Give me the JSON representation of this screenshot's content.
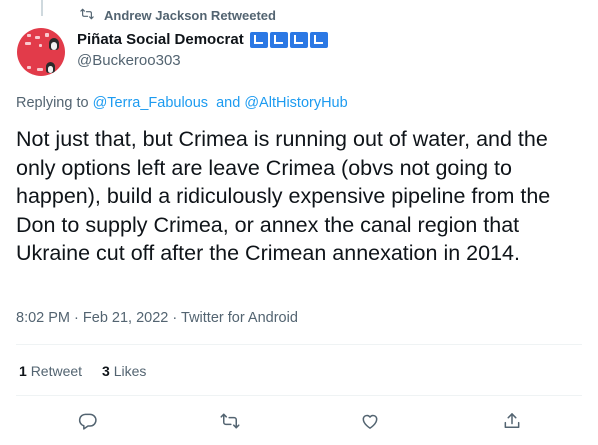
{
  "retweet_banner": {
    "icon": "retweet-icon",
    "text": "Andrew Jackson Retweeted"
  },
  "author": {
    "display_name": "Piñata Social Democrat",
    "handle": "@Buckeroo303",
    "avatar_color": "#e23b4a",
    "flag_badges": [
      "blue-check-flag",
      "blue-check-flag",
      "blue-check-flag",
      "blue-check-flag"
    ]
  },
  "reply": {
    "prefix": "Replying to",
    "first_handle": "@Terra_Fabulous",
    "joiner": "and",
    "second_handle": "@AltHistoryHub"
  },
  "tweet": {
    "text": "Not just that, but Crimea is running out of water, and the only options left are leave Crimea (obvs not going to happen), build a ridiculously expensive pipeline from the Don to supply Crimea, or annex the canal region that Ukraine cut off after the Crimean annexation in 2014."
  },
  "meta": {
    "time": "8:02 PM",
    "separator": "·",
    "date": "Feb 21, 2022",
    "source": "Twitter for Android"
  },
  "stats": {
    "retweets_count": "1",
    "retweets_label": "Retweet",
    "likes_count": "3",
    "likes_label": "Likes"
  },
  "actions": [
    "reply-icon",
    "retweet-icon",
    "like-icon",
    "share-icon"
  ],
  "colors": {
    "link": "#1d9bf0",
    "muted": "#536471",
    "text": "#0f1419",
    "divider": "#eff3f4"
  }
}
